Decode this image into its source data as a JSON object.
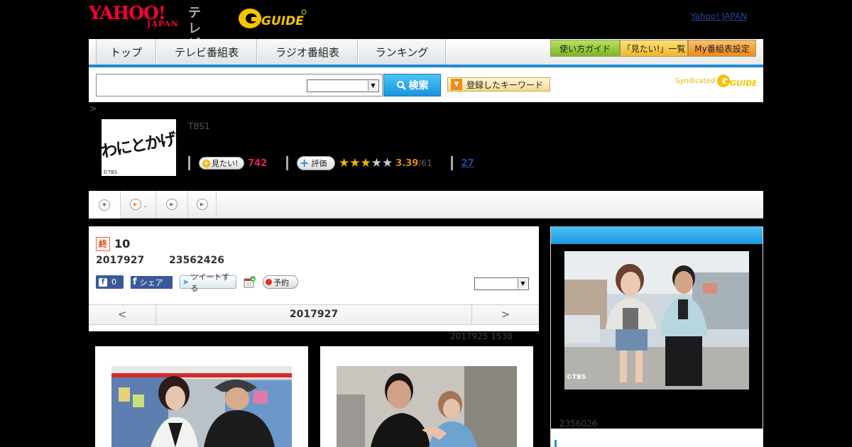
{
  "header": {
    "yahoo_logo_main": "YAHOO!",
    "yahoo_logo_sub": "JAPAN",
    "section": "テレビ",
    "gguide_logo": "G GUIDE",
    "yahoo_japan_link": "Yahoo! JAPAN"
  },
  "nav": {
    "tabs": [
      {
        "label": "トップ"
      },
      {
        "label": "テレビ番組表"
      },
      {
        "label": "ラジオ番組表"
      },
      {
        "label": "ランキング"
      }
    ],
    "buttons": [
      {
        "label": "使い方ガイド"
      },
      {
        "label": "「見たい!」一覧"
      },
      {
        "label": "My番組表設定"
      }
    ]
  },
  "search": {
    "button_label": "検索",
    "keyword_button": "登録したキーワード",
    "syndicated": "Syndicated"
  },
  "breadcrumb": ">",
  "program": {
    "thumb_text": "わにとかげぎす",
    "thumb_credit": "©TBS",
    "channel": "TBS1",
    "mitai_label": "見たい!",
    "mitai_count": "742",
    "hyoka_label": "評価",
    "rating": "3.39",
    "rating_count": "/61",
    "rating_value": 3,
    "review_count": "27"
  },
  "subtabs": {
    "second_label": "."
  },
  "episode": {
    "status_badge": "終",
    "title": "10",
    "date": "2017927",
    "time": "23562426",
    "fb_like_count": "0",
    "fb_share_label": "シェア",
    "tweet_label": "ツイートする",
    "reserve_label": "予約",
    "nav_prev": "<",
    "nav_date": "2017927",
    "nav_next": ">",
    "updated": "2017925  1538"
  },
  "rightpanel": {
    "photo_credit": "©TBS",
    "views": "2356026"
  },
  "colors": {
    "accent_blue": "#1a95dd",
    "yahoo_red": "#ff0033",
    "gguide_yellow": "#f5c400",
    "mitai_pink": "#e0245e",
    "rating_orange": "#e08a10"
  }
}
